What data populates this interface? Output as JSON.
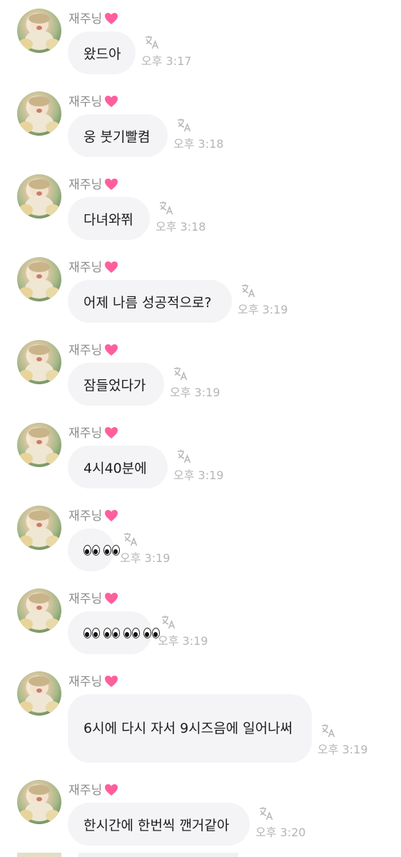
{
  "sender": {
    "name": "재주닝",
    "heart_icon": "pink-heart",
    "heart_color": "#ff5f9c"
  },
  "translate_icon": "translate-icon",
  "colors": {
    "bubble": "#f4f4f6",
    "meta": "#b5b5b9",
    "name": "#8a8a8a"
  },
  "messages": [
    {
      "text": "왔드아",
      "time": "오후 3:17"
    },
    {
      "text": "웅 붓기빨켬",
      "time": "오후 3:18"
    },
    {
      "text": "다녀와쮜",
      "time": "오후 3:18"
    },
    {
      "text": "어제 나름 성공적으로?",
      "time": "오후 3:19"
    },
    {
      "text": "잠들었다가",
      "time": "오후 3:19"
    },
    {
      "text": "4시40분에",
      "time": "오후 3:19"
    },
    {
      "text": "",
      "emoji": "eyes x2",
      "time": "오후 3:19"
    },
    {
      "text": "",
      "emoji": "eyes x4",
      "time": "오후 3:19"
    },
    {
      "text": "6시에 다시 자서 9시즈음에 일어나써",
      "time": "오후 3:19"
    },
    {
      "text": "한시간에 한번씩 깬거같아",
      "time": "오후 3:20"
    }
  ]
}
